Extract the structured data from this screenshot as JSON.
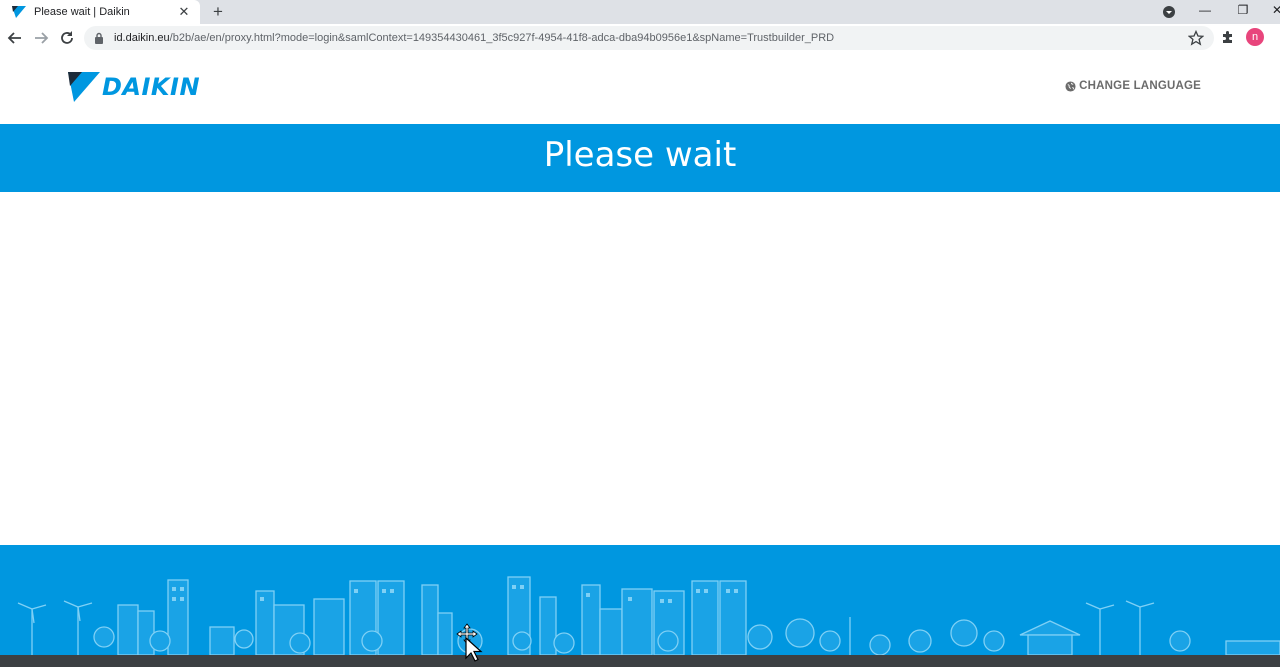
{
  "browser": {
    "tab_title": "Please wait | Daikin",
    "tab_close": "✕",
    "new_tab": "+",
    "url_host": "id.daikin.eu",
    "url_path": "/b2b/ae/en/proxy.html?mode=login&samlContext=149354430461_3f5c927f-4954-41f8-adca-dba94b0956e1&spName=Trustbuilder_PRD",
    "profile_initial": "n",
    "window_controls": {
      "minimize": "—",
      "restore": "❐",
      "close": "✕"
    }
  },
  "header": {
    "logo_text": "DAIKIN",
    "change_language": "CHANGE LANGUAGE"
  },
  "banner": {
    "title": "Please wait"
  },
  "colors": {
    "brand_blue": "#0097e0",
    "header_text_gray": "#6b6b6b",
    "skyline_line": "#7fd0f5"
  },
  "icons": [
    "daikin-logo-icon",
    "globe-icon",
    "back-arrow-icon",
    "forward-arrow-icon",
    "reload-icon",
    "lock-icon",
    "star-icon",
    "extensions-icon",
    "tab-search-icon",
    "move-cursor-icon"
  ]
}
